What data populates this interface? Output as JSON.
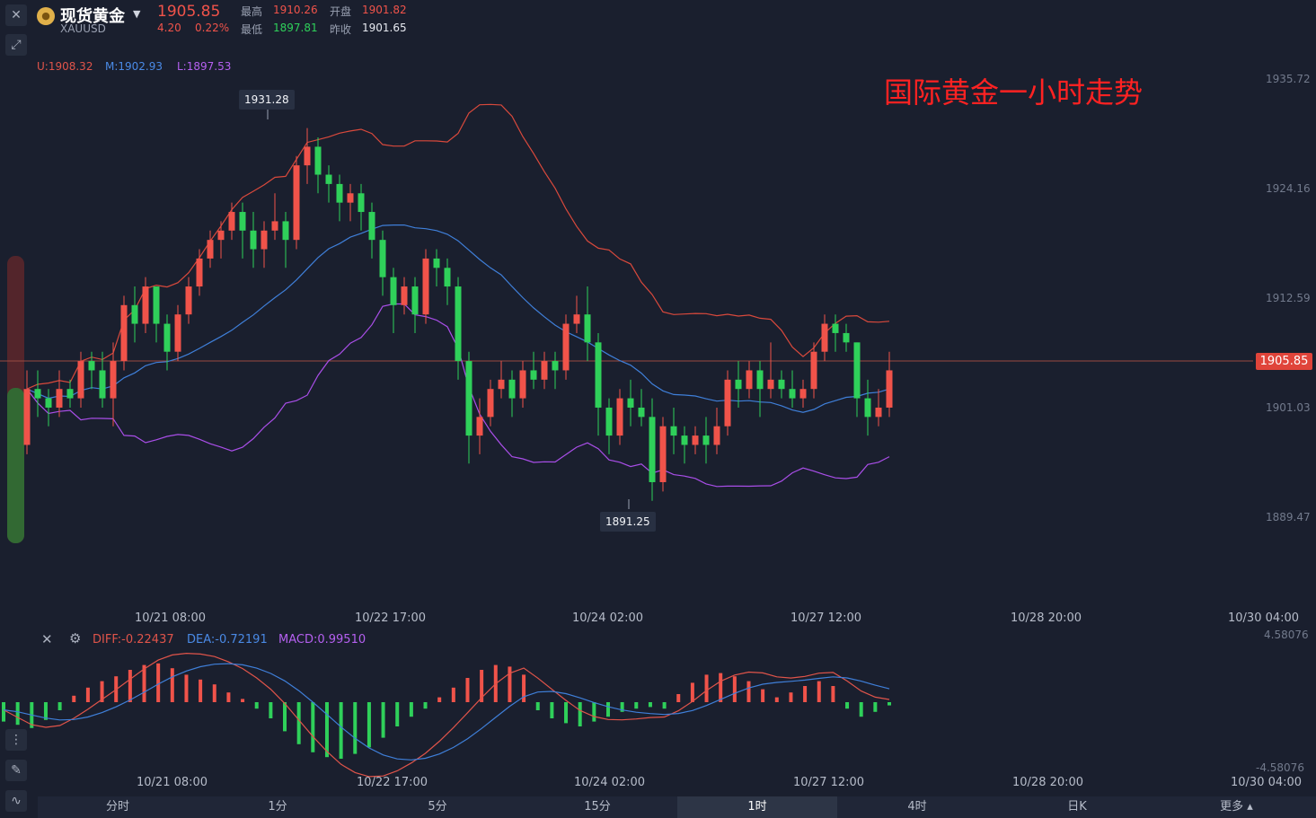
{
  "header": {
    "name": "现货黄金",
    "code": "XAUUSD",
    "price": "1905.85",
    "change": "4.20",
    "change_pct": "0.22%",
    "high_label": "最高",
    "high": "1910.26",
    "low_label": "最低",
    "low": "1897.81",
    "open_label": "开盘",
    "open": "1901.82",
    "prev_label": "昨收",
    "prev": "1901.65"
  },
  "boll": {
    "u": "U:1908.32",
    "m": "M:1902.93",
    "l": "L:1897.53"
  },
  "overlay_title": "国际黄金一小时走势",
  "markers": {
    "max": "1931.28",
    "min": "1891.25",
    "last": "1905.85"
  },
  "price_axis": [
    "1935.72",
    "1924.16",
    "1912.59",
    "1901.03",
    "1889.47"
  ],
  "time_axis_main": [
    "10/21 08:00",
    "10/22 17:00",
    "10/24 02:00",
    "10/27 12:00",
    "10/28 20:00",
    "10/30 04:00"
  ],
  "macd": {
    "diff": "DIFF:-0.22437",
    "dea": "DEA:-0.72191",
    "macd": "MACD:0.99510",
    "axis_top": "4.58076",
    "axis_bottom": "-4.58076",
    "time_axis": [
      "10/21 08:00",
      "10/22 17:00",
      "10/24 02:00",
      "10/27 12:00",
      "10/28 20:00",
      "10/30 04:00"
    ]
  },
  "timeframes": [
    "分时",
    "1分",
    "5分",
    "15分",
    "1时",
    "4时",
    "日K",
    "更多"
  ],
  "active_timeframe": "1时",
  "colors": {
    "up": "#f0534a",
    "down": "#2fd05a",
    "mid": "#3f7fd9",
    "lower": "#a94ee8",
    "upper": "#d9493c",
    "bg": "#1a1f2e"
  },
  "icons": [
    "close-icon",
    "draw-tool-icon",
    "coin-icon",
    "caret-down-icon",
    "settings-icon",
    "indicator-icon",
    "pen-icon",
    "line-chart-icon"
  ],
  "chart_data": {
    "type": "candlestick",
    "ylim": [
      1885,
      1938
    ],
    "candles": [
      [
        1897,
        1903,
        1896,
        1905
      ],
      [
        1903,
        1902,
        1900,
        1905
      ],
      [
        1902,
        1901,
        1899,
        1903
      ],
      [
        1901,
        1903,
        1900,
        1905
      ],
      [
        1903,
        1902,
        1901,
        1904
      ],
      [
        1902,
        1906,
        1901,
        1907
      ],
      [
        1906,
        1905,
        1903,
        1907
      ],
      [
        1905,
        1902,
        1901,
        1907
      ],
      [
        1902,
        1906,
        1899,
        1908
      ],
      [
        1906,
        1912,
        1905,
        1913
      ],
      [
        1912,
        1910,
        1908,
        1914
      ],
      [
        1910,
        1914,
        1909,
        1915
      ],
      [
        1914,
        1910,
        1908,
        1914
      ],
      [
        1910,
        1907,
        1905,
        1911
      ],
      [
        1907,
        1911,
        1906,
        1912
      ],
      [
        1911,
        1914,
        1910,
        1915
      ],
      [
        1914,
        1917,
        1913,
        1918
      ],
      [
        1917,
        1919,
        1916,
        1920
      ],
      [
        1919,
        1920,
        1917,
        1921
      ],
      [
        1920,
        1922,
        1919,
        1923
      ],
      [
        1922,
        1920,
        1917,
        1923
      ],
      [
        1920,
        1918,
        1916,
        1922
      ],
      [
        1918,
        1920,
        1916,
        1921
      ],
      [
        1920,
        1921,
        1919,
        1924
      ],
      [
        1921,
        1919,
        1916,
        1922
      ],
      [
        1919,
        1927,
        1918,
        1928
      ],
      [
        1927,
        1929,
        1925,
        1931
      ],
      [
        1929,
        1926,
        1924,
        1930
      ],
      [
        1926,
        1925,
        1923,
        1927
      ],
      [
        1925,
        1923,
        1921,
        1926
      ],
      [
        1923,
        1924,
        1921,
        1925
      ],
      [
        1924,
        1922,
        1920,
        1925
      ],
      [
        1922,
        1919,
        1917,
        1923
      ],
      [
        1919,
        1915,
        1913,
        1920
      ],
      [
        1915,
        1912,
        1909,
        1916
      ],
      [
        1912,
        1914,
        1911,
        1915
      ],
      [
        1914,
        1911,
        1909,
        1915
      ],
      [
        1911,
        1917,
        1910,
        1918
      ],
      [
        1917,
        1916,
        1914,
        1918
      ],
      [
        1916,
        1914,
        1912,
        1917
      ],
      [
        1914,
        1906,
        1904,
        1915
      ],
      [
        1906,
        1898,
        1895,
        1907
      ],
      [
        1898,
        1900,
        1896,
        1902
      ],
      [
        1900,
        1903,
        1899,
        1904
      ],
      [
        1903,
        1904,
        1902,
        1906
      ],
      [
        1904,
        1902,
        1900,
        1905
      ],
      [
        1902,
        1905,
        1901,
        1906
      ],
      [
        1905,
        1904,
        1903,
        1907
      ],
      [
        1904,
        1906,
        1903,
        1907
      ],
      [
        1906,
        1905,
        1903,
        1907
      ],
      [
        1905,
        1910,
        1904,
        1911
      ],
      [
        1910,
        1911,
        1909,
        1913
      ],
      [
        1911,
        1908,
        1906,
        1914
      ],
      [
        1908,
        1901,
        1898,
        1909
      ],
      [
        1901,
        1898,
        1896,
        1902
      ],
      [
        1898,
        1902,
        1897,
        1903
      ],
      [
        1902,
        1901,
        1899,
        1904
      ],
      [
        1901,
        1900,
        1899,
        1903
      ],
      [
        1900,
        1893,
        1891,
        1902
      ],
      [
        1893,
        1899,
        1892,
        1900
      ],
      [
        1899,
        1898,
        1896,
        1901
      ],
      [
        1898,
        1897,
        1895,
        1899
      ],
      [
        1897,
        1898,
        1896,
        1899
      ],
      [
        1898,
        1897,
        1895,
        1900
      ],
      [
        1897,
        1899,
        1896,
        1901
      ],
      [
        1899,
        1904,
        1898,
        1905
      ],
      [
        1904,
        1903,
        1901,
        1906
      ],
      [
        1903,
        1905,
        1902,
        1906
      ],
      [
        1905,
        1903,
        1900,
        1906
      ],
      [
        1903,
        1904,
        1902,
        1908
      ],
      [
        1904,
        1903,
        1902,
        1905
      ],
      [
        1903,
        1902,
        1901,
        1905
      ],
      [
        1902,
        1903,
        1901,
        1904
      ],
      [
        1903,
        1907,
        1902,
        1908
      ],
      [
        1907,
        1910,
        1906,
        1911
      ],
      [
        1910,
        1909,
        1907,
        1911
      ],
      [
        1909,
        1908,
        1907,
        1910
      ],
      [
        1908,
        1902,
        1900,
        1908
      ],
      [
        1902,
        1900,
        1898,
        1904
      ],
      [
        1900,
        1901,
        1899,
        1903
      ],
      [
        1901,
        1905,
        1900,
        1907
      ]
    ],
    "macd_hist": [
      -1.2,
      -1.4,
      -1.6,
      -1.1,
      -0.5,
      0.4,
      0.9,
      1.3,
      1.6,
      2.0,
      2.3,
      2.4,
      2.1,
      1.7,
      1.4,
      1.1,
      0.6,
      0.2,
      -0.4,
      -1.0,
      -1.8,
      -2.6,
      -3.1,
      -3.4,
      -3.5,
      -3.2,
      -2.8,
      -2.2,
      -1.5,
      -0.9,
      -0.4,
      0.3,
      0.9,
      1.5,
      2.0,
      2.3,
      2.2,
      1.7,
      -0.5,
      -1.0,
      -1.3,
      -1.5,
      -1.2,
      -0.9,
      -0.6,
      -0.4,
      -0.3,
      -0.4,
      0.5,
      1.2,
      1.7,
      1.8,
      1.6,
      1.3,
      0.8,
      0.3,
      0.6,
      1.0,
      1.3,
      1.0,
      -0.4,
      -0.9,
      -0.6,
      -0.2
    ]
  }
}
